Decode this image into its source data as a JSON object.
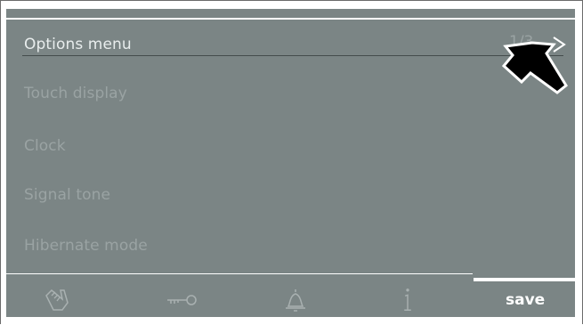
{
  "menu": {
    "title": "Options menu",
    "page_indicator": "1/3",
    "items": [
      {
        "label": "Touch display"
      },
      {
        "label": "Clock"
      },
      {
        "label": "Signal tone"
      },
      {
        "label": "Hibernate mode"
      }
    ]
  },
  "footer": {
    "icons": [
      "hand-icon",
      "key-icon",
      "bell-icon",
      "info-icon"
    ],
    "save_label": "save"
  },
  "colors": {
    "screen_bg": "#7b8585",
    "active_text": "#e8eded",
    "inactive_text": "#9aa3a3",
    "highlight": "#ffffff"
  }
}
